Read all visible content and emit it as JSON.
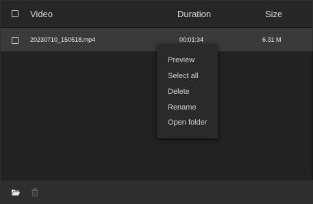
{
  "header": {
    "video_label": "Video",
    "duration_label": "Duration",
    "size_label": "Size"
  },
  "rows": [
    {
      "name": "20230710_150518.mp4",
      "duration": "00:01:34",
      "size": "6.31 M",
      "selected": true
    }
  ],
  "context_menu": {
    "items": [
      "Preview",
      "Select all",
      "Delete",
      "Rename",
      "Open folder"
    ]
  },
  "footer": {
    "icons": [
      "folder-icon",
      "trash-icon"
    ]
  },
  "colors": {
    "background": "#232323",
    "header_bg": "#262626",
    "selected_row_bg": "#3a3a3a",
    "menu_bg": "#2a2a2a",
    "footer_bg": "#2e2e2e",
    "text": "#d8d8d8"
  }
}
